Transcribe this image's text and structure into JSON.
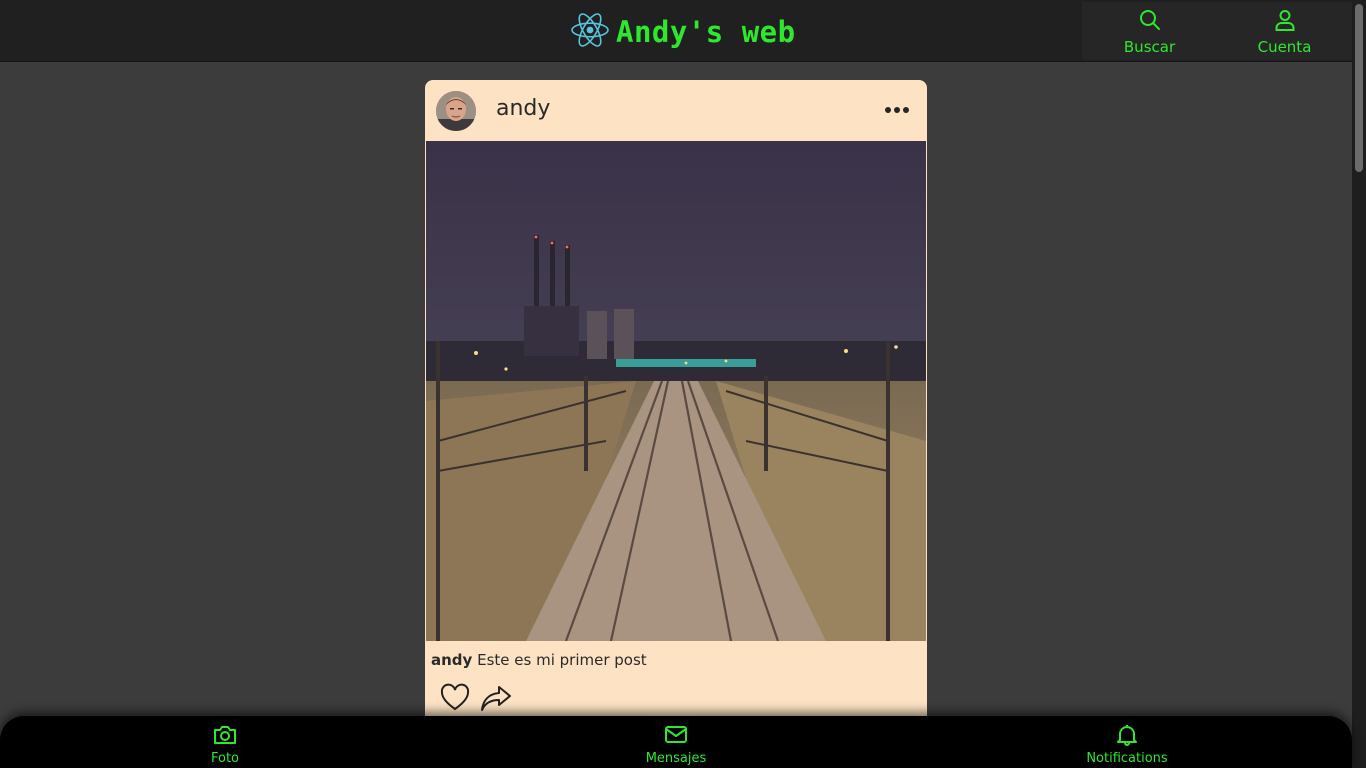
{
  "header": {
    "title": "Andy's web",
    "logo_icon": "react-atom-icon",
    "logo_color": "#58c4dc",
    "accent": "#2ee82e",
    "actions": [
      {
        "label": "Buscar",
        "icon": "search-icon"
      },
      {
        "label": "Cuenta",
        "icon": "user-icon"
      }
    ]
  },
  "post": {
    "username": "andy",
    "avatar": "avatar-photo",
    "image": "railway-tracks-night-photo",
    "caption_user": "andy",
    "caption_text": "Este es mi primer post",
    "actions": [
      {
        "icon": "heart-icon"
      },
      {
        "icon": "share-icon"
      }
    ],
    "background": "#fde3c4"
  },
  "bottom_nav": {
    "items": [
      {
        "label": "Foto",
        "icon": "camera-icon"
      },
      {
        "label": "Mensajes",
        "icon": "mail-icon"
      },
      {
        "label": "Notifications",
        "icon": "bell-icon"
      }
    ]
  }
}
